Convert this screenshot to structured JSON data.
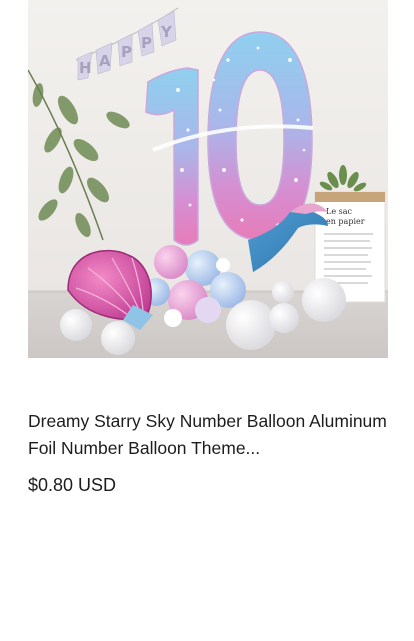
{
  "product": {
    "title": "Dreamy Starry Sky Number Balloon Aluminum Foil Number Balloon Theme...",
    "price": "$0.80 USD",
    "image": {
      "alt": "Pink and blue gradient number 10 foil balloon with mermaid tail, seashell balloon and white latex balloons",
      "banner_text": "HAPPY",
      "bag_title_1": "Le sac",
      "bag_title_2": "en papier"
    }
  },
  "colors": {
    "text": "#1d1d1d",
    "background": "#ffffff",
    "balloon_blue": "#8ecbea",
    "balloon_pink": "#e58ac6"
  }
}
